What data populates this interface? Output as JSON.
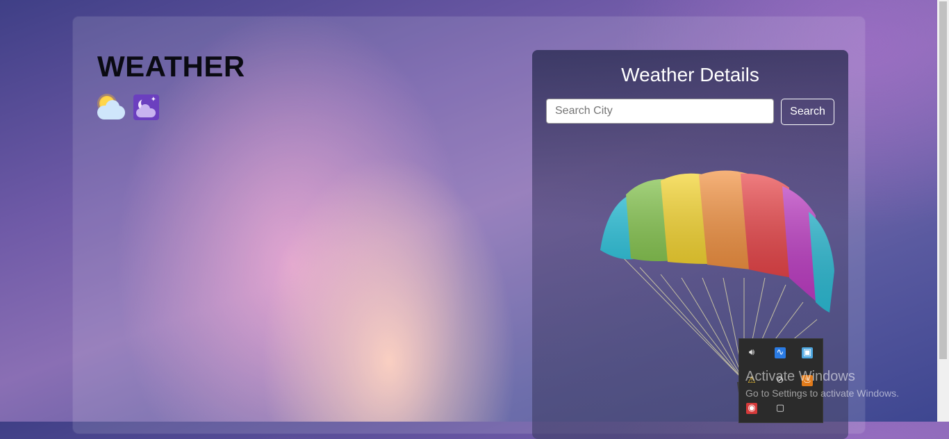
{
  "app": {
    "title": "WEATHER",
    "icons": [
      "sun-behind-cloud-icon",
      "night-moon-cloud-icon"
    ]
  },
  "panel": {
    "title": "Weather Details",
    "search": {
      "placeholder": "Search City",
      "value": ""
    },
    "search_button": "Search",
    "illustration": "parachute-image"
  },
  "system_tray": {
    "icons": [
      "volume-icon",
      "waveform-app-icon",
      "network-adapter-icon",
      "security-warning-icon",
      "camera-off-icon",
      "java-icon",
      "red-app-icon",
      "white-app-icon"
    ]
  },
  "activate_windows": {
    "title": "Activate Windows",
    "subtitle": "Go to Settings to activate Windows."
  },
  "colors": {
    "panel_bg": "#2a2c50",
    "accent_moon_bg": "#6b3fbf",
    "title_text": "#0a0a12"
  }
}
